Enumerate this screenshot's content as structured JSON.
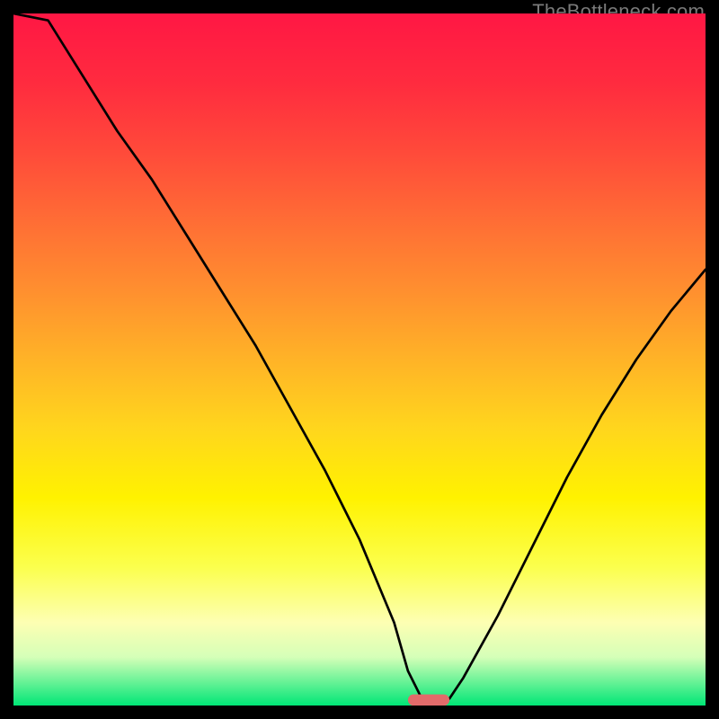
{
  "watermark": "TheBottleneck.com",
  "chart_data": {
    "type": "line",
    "title": "",
    "xlabel": "",
    "ylabel": "",
    "xlim": [
      0,
      100
    ],
    "ylim": [
      0,
      100
    ],
    "grid": false,
    "legend": false,
    "series": [
      {
        "name": "bottleneck-curve",
        "x": [
          0,
          5,
          10,
          15,
          20,
          25,
          30,
          35,
          40,
          45,
          50,
          55,
          57,
          59,
          60,
          61,
          63,
          65,
          70,
          75,
          80,
          85,
          90,
          95,
          100
        ],
        "y": [
          100,
          99,
          91,
          83,
          76,
          68,
          60,
          52,
          43,
          34,
          24,
          12,
          5,
          1,
          0,
          0,
          1,
          4,
          13,
          23,
          33,
          42,
          50,
          57,
          63
        ]
      }
    ],
    "marker": {
      "name": "optimal-point",
      "shape": "capsule",
      "cx": 60,
      "cy": 0,
      "width": 6,
      "height": 1.8,
      "color": "#e26a6a"
    },
    "background_gradient": {
      "type": "vertical",
      "stops": [
        {
          "pos": 0.0,
          "color": "#ff1744"
        },
        {
          "pos": 0.5,
          "color": "#ffb327"
        },
        {
          "pos": 0.7,
          "color": "#fff200"
        },
        {
          "pos": 0.93,
          "color": "#d5ffb8"
        },
        {
          "pos": 1.0,
          "color": "#00e676"
        }
      ]
    }
  }
}
